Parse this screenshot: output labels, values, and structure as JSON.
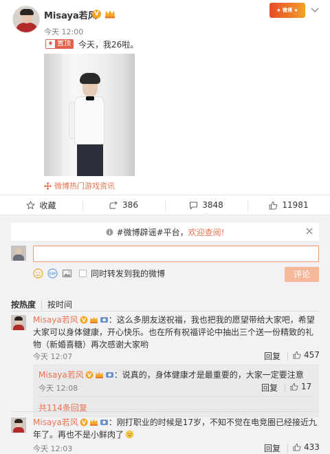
{
  "post": {
    "username": "Misaya若风",
    "time": "今天 12:00",
    "pin_label": "置顶",
    "text": "今天，我26啦。",
    "game_link": "微博热门游戏资讯",
    "actions": {
      "favorite": "收藏",
      "repost_count": "386",
      "comment_count": "3848",
      "like_count": "11981"
    }
  },
  "notice": {
    "text_prefix": "#微博辟谣#平台，",
    "text_highlight": "欢迎查阅!"
  },
  "compose": {
    "input_value": "",
    "sync_label": "同时转发到我的微博",
    "submit_label": "评论"
  },
  "sort": {
    "hot": "按热度",
    "time": "按时间"
  },
  "comments": [
    {
      "user": "Misaya若风",
      "text": "：这么多朋友送祝福，我也把我的愿望带给大家吧，希望大家可以身体健康，开心快乐。也在所有祝福评论中抽出三个送一份精致的礼物（新婚喜糖）再次感谢大家哟",
      "time": "今天 12:07",
      "reply_label": "回复",
      "likes": "457",
      "reply": {
        "user": "Misaya若风",
        "text": "：说真的，身体健康才是最重要的，大家一定要注意",
        "time": "今天 12:08",
        "reply_label": "回复",
        "likes": "17"
      },
      "more_replies": "共114条回复"
    },
    {
      "user": "Misaya若风",
      "text": "：刚打职业的时候是17岁，不知不觉在电竞圈已经接近九年了。再也不是小鲜肉了",
      "time": "今天 12:03",
      "reply_label": "回复",
      "likes": "433"
    }
  ],
  "colors": {
    "accent": "#eb7350",
    "panel_bg": "#f2f2f5",
    "submit_disabled": "#f7b79b"
  }
}
